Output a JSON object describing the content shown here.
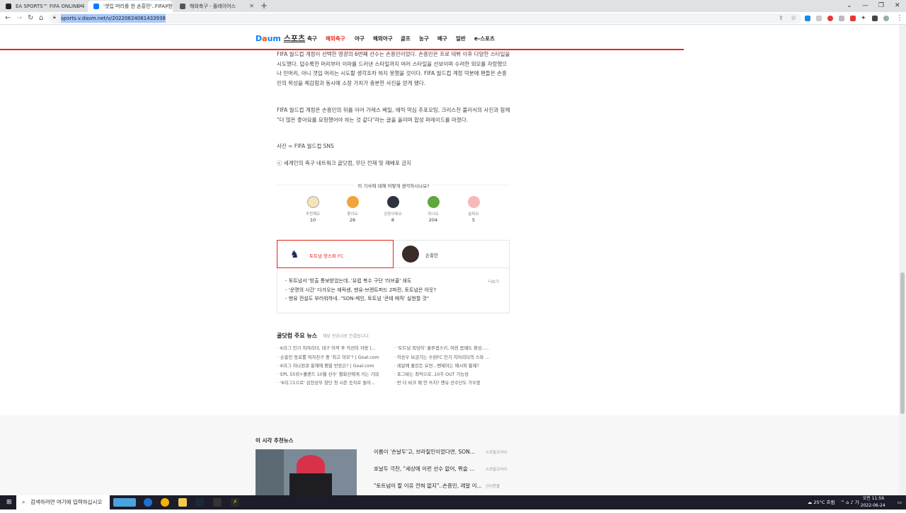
{
  "browser": {
    "tabs": [
      {
        "title": "EA SPORTS™ FIFA ONLINE 4"
      },
      {
        "title": "'갯입 머리를 한 손흥민'..FIFA, 한"
      },
      {
        "title": "해외축구 - 플레이어스"
      }
    ],
    "url": "sports.v.daum.net/v/20220624061433938"
  },
  "site": {
    "logo": "스포츠",
    "nav": [
      "축구",
      "해외축구",
      "야구",
      "해외야구",
      "골프",
      "농구",
      "배구",
      "일반",
      "e-스포츠"
    ],
    "active_nav": "해외축구"
  },
  "article": {
    "p1": "FIFA 월드컵 계정이 선택한 영광의 6번째 선수는 손흥민이었다. 손흥민은 프로 데뷔 이후 다양한 스타일을 시도했다. 덥수룩한 머리부터 이마를 드러낸 스타일까지 여러 스타일을 선보이며 수려한 외모를 자랑했으나 민머리, 아니 갯입 머리는 시도할 생각조차 하지 못했을 것이다. FIFA 월드컵 계정 덕분에 팬들은 손흥민의 위상을 체감함과 동시에 소장 가치가 충분한 사진을 얻게 됐다.",
    "p2": "FIFA 월드컵 계정은 손흥민의 뒤를 이어 가레스 베일, 에릭 막심 추포모팅, 크리스천 풀리식의 사진과 함께 \"더 많은 좋아요를 요청했어야 하는 것 같다\"라는 글을 올리며 합성 퍼레이드를 마쳤다.",
    "photo": "사진 = FIFA 월드컵 SNS",
    "copyright": "ⓒ 세계인의 축구 네트워크 골닷컴, 무단 전재 및 재배포 금지"
  },
  "reactions": {
    "title": "이 기사에 대해 어떻게 생각하시나요?",
    "items": [
      {
        "label": "추천해요",
        "count": "10",
        "color": "#f3e3b8"
      },
      {
        "label": "좋아요",
        "count": "26",
        "color": "#f0a43a"
      },
      {
        "label": "감동이에요",
        "count": "8",
        "color": "#2d3440"
      },
      {
        "label": "화나요",
        "count": "204",
        "color": "#5ea83d"
      },
      {
        "label": "슬퍼요",
        "count": "5",
        "color": "#f6b8b8"
      }
    ]
  },
  "team": {
    "tab_a": "토트넘 핫스퍼 FC",
    "tab_b": "손흥민",
    "more": "더보기",
    "news": [
      "토트넘서 '방출 통보받았는데..'유럽 복수 구단 '러브콜' 쇄도",
      "'운명의 시간' 다가오는 에릭센, 맨유-브렌트퍼드 2파전, 토트넘은 아웃?",
      "맨유 전설도 부러워하네..\"SON-케인, 토트넘 '콘테 매직' 실현할 것\""
    ]
  },
  "goal": {
    "title": "골닷컴 주요 뉴스",
    "subtitle": "해당 언론사로 연결됩니다.",
    "left": [
      "K리그 인기 치어리더, 대구 이적 후 각선미 자랑 [...",
      "손흥민 동료를 여자친구 중 '최고 미모'? | Goal.com",
      "K리그 하나원큐 올해에 팬을 반응은? | Goal.com",
      "EPL 55위+홀랜드 10월 선수' 활화산에게 거는 기대",
      "'K리그1으로' 김천상무 창단 첫 시즌 숫자로 돌아..."
    ],
    "right": [
      "'토트넘 복덩이' 쿨루셉스키, 여전 몸매도 환상.....",
      "이승우 보금가는 수원FC 인기 치어리더의 스파 ...",
      "레알에 흘린든 요연...벤제마는 예시와 황제?",
      "포그바는 최악으로..10주 OUT 가능성",
      "반 더 비크 왜 안 쓰지? 맨유 선수단도 가우뚱"
    ]
  },
  "recommend": {
    "title": "이 시각 추천뉴스",
    "items": [
      {
        "headline": "이름이 '손날두'고, 브라질인이었다면, SON...",
        "source": "스포탈코리아"
      },
      {
        "headline": "호날두 극찬, \"세상에 이런 선수 없어, 뛰슬 ...",
        "source": "스포탈코리아"
      },
      {
        "headline": "\"토트넘이 팔 이유 전혀 없지\"..손흥민, 레알 이...",
        "source": "인터풋볼"
      }
    ]
  },
  "taskbar": {
    "search_placeholder": "검색하려면 여기에 입력하십시오",
    "weather": "25°C 흐림",
    "time": "오전 11:56",
    "date": "2022-06-24",
    "ime": "가"
  }
}
